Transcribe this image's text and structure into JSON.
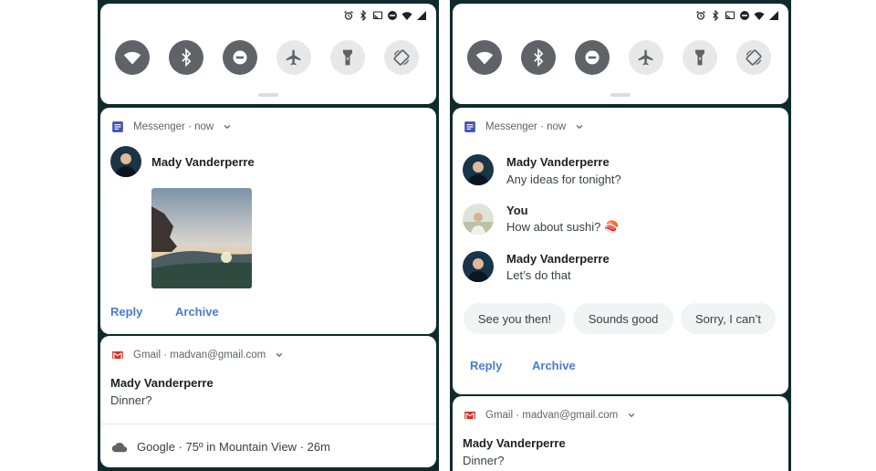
{
  "left": {
    "messenger": {
      "app_line": "Messenger · now",
      "sender": "Mady Vanderperre",
      "actions": {
        "reply": "Reply",
        "archive": "Archive"
      }
    },
    "gmail": {
      "app_line": "Gmail · madvan@gmail.com",
      "sender": "Mady Vanderperre",
      "message": "Dinner?"
    },
    "google": {
      "app_line": "Google · 75º in Mountain View · 26m"
    }
  },
  "right": {
    "messenger": {
      "app_line": "Messenger · now",
      "messages": [
        {
          "sender": "Mady Vanderperre",
          "text": "Any ideas for tonight?"
        },
        {
          "sender": "You",
          "text": "How about sushi? 🍣"
        },
        {
          "sender": "Mady Vanderperre",
          "text": "Let’s do that"
        }
      ],
      "smart_replies": [
        "See you then!",
        "Sounds good",
        "Sorry, I can’t"
      ],
      "actions": {
        "reply": "Reply",
        "archive": "Archive"
      }
    },
    "gmail": {
      "app_line": "Gmail · madvan@gmail.com",
      "sender": "Mady Vanderperre",
      "message": "Dinner?"
    }
  },
  "icons": {
    "status": [
      "alarm-icon",
      "bluetooth-icon",
      "cast-icon",
      "do-not-disturb-icon",
      "wifi-icon",
      "signal-icon"
    ],
    "quick_settings": [
      "wifi-icon",
      "bluetooth-icon",
      "do-not-disturb-icon",
      "airplane-icon",
      "flashlight-icon",
      "auto-rotate-icon"
    ]
  },
  "colors": {
    "accent": "#4a7bd0",
    "tile_on": "#5f6368",
    "tile_off": "#e8e8e8",
    "messenger": "#3f51b5",
    "gmail": "#d93025",
    "wallpaper": "#0f2a2c"
  }
}
